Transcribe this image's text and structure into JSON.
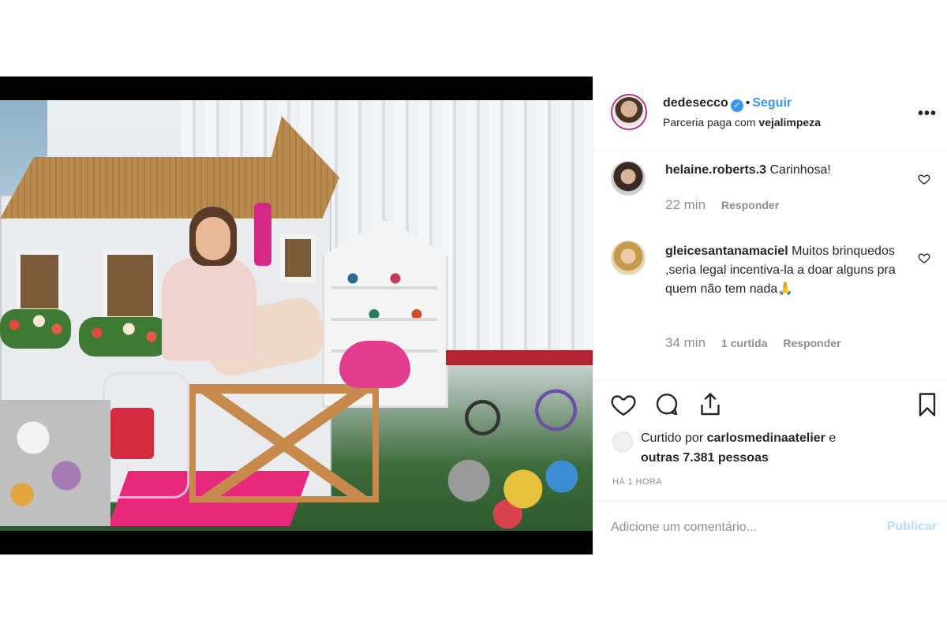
{
  "post": {
    "username": "dedesecco",
    "verified_icon": "verified-badge-icon",
    "dot": "•",
    "follow_label": "Seguir",
    "partnership_prefix": "Parceria paga com",
    "partner_name": "vejalimpeza",
    "more_label": "•••"
  },
  "comments": [
    {
      "username": "helaine.roberts.3",
      "text": "Carinhosa!",
      "time": "22 min",
      "reply_label": "Responder"
    },
    {
      "username": "gleicesantanamaciel",
      "text": "Muitos brinquedos ,seria legal incentiva-la a doar alguns pra quem não tem nada🙏",
      "time": "34 min",
      "likes_label": "1 curtida",
      "reply_label": "Responder"
    }
  ],
  "actions": {
    "liked_by_prefix": "Curtido por",
    "liked_by_user": "carlosmedinaatelier",
    "liked_by_suffix": "e",
    "others": "outras 7.381 pessoas",
    "time_ago": "HÁ 1 HORA"
  },
  "add_comment": {
    "placeholder": "Adicione um comentário...",
    "publish_label": "Publicar"
  },
  "colors": {
    "link_blue": "#3897f0",
    "publish_disabled": "#b2dffc",
    "muted": "#8e8e8e",
    "text": "#262626"
  }
}
